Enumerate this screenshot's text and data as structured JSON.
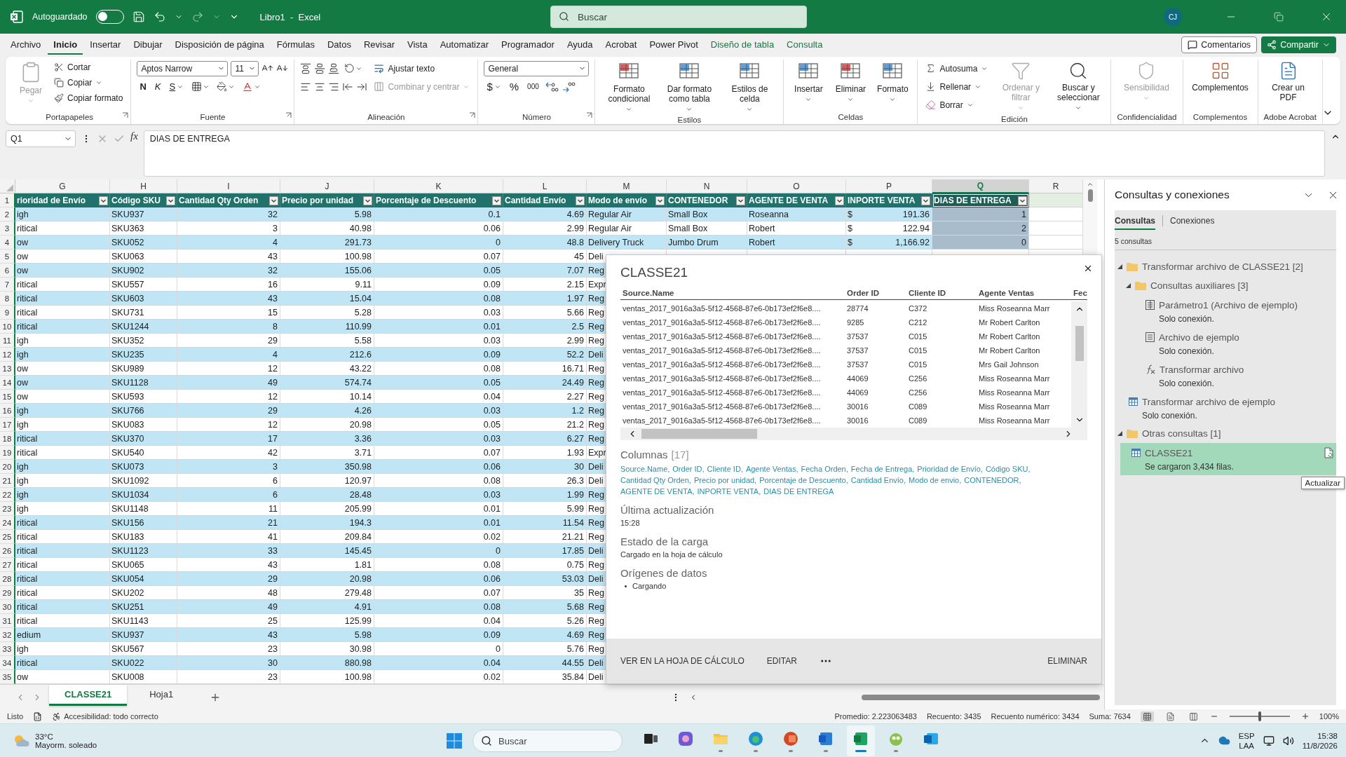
{
  "title_bar": {
    "autosave_label": "Autoguardado",
    "autosave_on": false,
    "title": "Libro1  -  Excel",
    "search_placeholder": "Buscar",
    "avatar": "CJ"
  },
  "menu_tabs": [
    {
      "label": "Archivo",
      "selected": false,
      "contextual": false
    },
    {
      "label": "Inicio",
      "selected": true,
      "contextual": false
    },
    {
      "label": "Insertar",
      "selected": false,
      "contextual": false
    },
    {
      "label": "Dibujar",
      "selected": false,
      "contextual": false
    },
    {
      "label": "Disposición de página",
      "selected": false,
      "contextual": false
    },
    {
      "label": "Fórmulas",
      "selected": false,
      "contextual": false
    },
    {
      "label": "Datos",
      "selected": false,
      "contextual": false
    },
    {
      "label": "Revisar",
      "selected": false,
      "contextual": false
    },
    {
      "label": "Vista",
      "selected": false,
      "contextual": false
    },
    {
      "label": "Automatizar",
      "selected": false,
      "contextual": false
    },
    {
      "label": "Programador",
      "selected": false,
      "contextual": false
    },
    {
      "label": "Ayuda",
      "selected": false,
      "contextual": false
    },
    {
      "label": "Acrobat",
      "selected": false,
      "contextual": false
    },
    {
      "label": "Power Pivot",
      "selected": false,
      "contextual": false
    },
    {
      "label": "Diseño de tabla",
      "selected": false,
      "contextual": true
    },
    {
      "label": "Consulta",
      "selected": false,
      "contextual": true
    }
  ],
  "header_buttons": {
    "comments": "Comentarios",
    "share": "Compartir"
  },
  "ribbon": [
    {
      "kind": "clipboard",
      "label": "Portapapeles",
      "paste": {
        "label": "Pegar",
        "disabled": true
      },
      "actions": [
        {
          "label": "Cortar"
        },
        {
          "label": "Copiar"
        },
        {
          "label": "Copiar formato"
        }
      ]
    },
    {
      "kind": "font",
      "label": "Fuente",
      "font_name": "Aptos Narrow",
      "font_size": "11",
      "styles": [
        "N",
        "K",
        "S"
      ]
    },
    {
      "kind": "alignment",
      "label": "Alineación",
      "wrap": {
        "label": "Ajustar texto",
        "disabled": false
      },
      "merge": {
        "label": "Combinar y centrar",
        "disabled": true
      }
    },
    {
      "kind": "number",
      "label": "Número",
      "format": "General",
      "symbols": [
        "$",
        "%",
        "000"
      ]
    },
    {
      "kind": "styles",
      "label": "Estilos",
      "buttons": [
        {
          "label": "Formato condicional"
        },
        {
          "label": "Dar formato como tabla"
        },
        {
          "label": "Estilos de celda"
        }
      ]
    },
    {
      "kind": "cells",
      "label": "Celdas",
      "buttons": [
        {
          "label": "Insertar"
        },
        {
          "label": "Eliminar"
        },
        {
          "label": "Formato"
        }
      ]
    },
    {
      "kind": "editing",
      "label": "Edición",
      "actions": [
        {
          "label": "Autosuma"
        },
        {
          "label": "Rellenar"
        },
        {
          "label": "Borrar"
        }
      ],
      "buttons": [
        {
          "label": "Ordenar y filtrar",
          "disabled": true
        },
        {
          "label": "Buscar y seleccionar",
          "disabled": false
        }
      ]
    },
    {
      "kind": "sensitivity",
      "label": "Confidencialidad",
      "buttons": [
        {
          "label": "Sensibilidad",
          "disabled": true
        }
      ]
    },
    {
      "kind": "addins",
      "label": "Complementos",
      "buttons": [
        {
          "label": "Complementos"
        }
      ]
    },
    {
      "kind": "acrobat",
      "label": "Adobe Acrobat",
      "buttons": [
        {
          "label": "Crear un PDF"
        }
      ]
    }
  ],
  "formula_bar": {
    "name_box": "Q1",
    "fx": "fx",
    "formula": "DIAS DE ENTREGA"
  },
  "sheet": {
    "column_letters": [
      {
        "letter": "G",
        "selected": false
      },
      {
        "letter": "H",
        "selected": false
      },
      {
        "letter": "I",
        "selected": false
      },
      {
        "letter": "J",
        "selected": false
      },
      {
        "letter": "K",
        "selected": false
      },
      {
        "letter": "L",
        "selected": false
      },
      {
        "letter": "M",
        "selected": false
      },
      {
        "letter": "N",
        "selected": false
      },
      {
        "letter": "O",
        "selected": false
      },
      {
        "letter": "P",
        "selected": false
      },
      {
        "letter": "Q",
        "selected": true
      },
      {
        "letter": "R",
        "selected": false
      }
    ],
    "header_row": {
      "number": "1",
      "labels": [
        "rioridad de Envío",
        "Código SKU",
        "Cantidad Qty Orden",
        "Precio por unidad",
        "Porcentaje de Descuento",
        "Cantidad Envío",
        "Modo de envío",
        "CONTENEDOR",
        "AGENTE DE VENTA",
        "INPORTE VENTA",
        "DIAS DE ENTREGA"
      ]
    },
    "rows": [
      {
        "number": "2",
        "currency": "$",
        "cells": [
          "igh",
          "SKU937",
          "32",
          "5.98",
          "0.1",
          "4.69",
          "Regular Air",
          "Small Box",
          "Roseanna",
          "191.36",
          "1"
        ]
      },
      {
        "number": "3",
        "currency": "$",
        "cells": [
          "ritical",
          "SKU363",
          "3",
          "40.98",
          "0.06",
          "2.99",
          "Regular Air",
          "Small Box",
          "Robert",
          "122.94",
          "2"
        ]
      },
      {
        "number": "4",
        "currency": "$",
        "cells": [
          "ow",
          "SKU052",
          "4",
          "291.73",
          "0",
          "48.8",
          "Delivery Truck",
          "Jumbo Drum",
          "Robert",
          "1,166.92",
          "0"
        ]
      },
      {
        "number": "5",
        "cells": [
          "ow",
          "SKU063",
          "43",
          "100.98",
          "0.07",
          "45",
          "Deli"
        ]
      },
      {
        "number": "6",
        "cells": [
          "ow",
          "SKU902",
          "32",
          "155.06",
          "0.05",
          "7.07",
          "Reg"
        ]
      },
      {
        "number": "7",
        "cells": [
          "ritical",
          "SKU557",
          "16",
          "9.11",
          "0.09",
          "2.15",
          "Expr"
        ]
      },
      {
        "number": "8",
        "cells": [
          "ritical",
          "SKU603",
          "43",
          "15.04",
          "0.08",
          "1.97",
          "Reg"
        ]
      },
      {
        "number": "9",
        "cells": [
          "ritical",
          "SKU731",
          "15",
          "5.28",
          "0.03",
          "5.66",
          "Reg"
        ]
      },
      {
        "number": "10",
        "cells": [
          "ritical",
          "SKU1244",
          "8",
          "110.99",
          "0.01",
          "2.5",
          "Reg"
        ]
      },
      {
        "number": "11",
        "cells": [
          "igh",
          "SKU352",
          "29",
          "5.58",
          "0.03",
          "2.99",
          "Reg"
        ]
      },
      {
        "number": "12",
        "cells": [
          "igh",
          "SKU235",
          "4",
          "212.6",
          "0.09",
          "52.2",
          "Deli"
        ]
      },
      {
        "number": "13",
        "cells": [
          "ow",
          "SKU989",
          "12",
          "43.22",
          "0.08",
          "16.71",
          "Reg"
        ]
      },
      {
        "number": "14",
        "cells": [
          "ow",
          "SKU1128",
          "49",
          "574.74",
          "0.05",
          "24.49",
          "Reg"
        ]
      },
      {
        "number": "15",
        "cells": [
          "ow",
          "SKU593",
          "12",
          "10.14",
          "0.04",
          "2.27",
          "Reg"
        ]
      },
      {
        "number": "16",
        "cells": [
          "igh",
          "SKU766",
          "29",
          "4.26",
          "0.03",
          "1.2",
          "Reg"
        ]
      },
      {
        "number": "17",
        "cells": [
          "igh",
          "SKU083",
          "12",
          "20.98",
          "0.05",
          "21.2",
          "Reg"
        ]
      },
      {
        "number": "18",
        "cells": [
          "ritical",
          "SKU370",
          "17",
          "3.36",
          "0.03",
          "6.27",
          "Reg"
        ]
      },
      {
        "number": "19",
        "cells": [
          "ritical",
          "SKU540",
          "42",
          "3.71",
          "0.07",
          "1.93",
          "Expr"
        ]
      },
      {
        "number": "20",
        "cells": [
          "igh",
          "SKU073",
          "3",
          "350.98",
          "0.06",
          "30",
          "Deli"
        ]
      },
      {
        "number": "21",
        "cells": [
          "igh",
          "SKU1092",
          "6",
          "120.97",
          "0.08",
          "26.3",
          "Deli"
        ]
      },
      {
        "number": "22",
        "cells": [
          "igh",
          "SKU1034",
          "6",
          "28.48",
          "0.03",
          "1.99",
          "Reg"
        ]
      },
      {
        "number": "23",
        "cells": [
          "igh",
          "SKU1148",
          "11",
          "205.99",
          "0.01",
          "5.99",
          "Reg"
        ]
      },
      {
        "number": "24",
        "cells": [
          "ritical",
          "SKU156",
          "21",
          "194.3",
          "0.01",
          "11.54",
          "Reg"
        ]
      },
      {
        "number": "25",
        "cells": [
          "ritical",
          "SKU183",
          "41",
          "209.84",
          "0.02",
          "21.21",
          "Reg"
        ]
      },
      {
        "number": "26",
        "cells": [
          "ritical",
          "SKU1123",
          "33",
          "145.45",
          "0",
          "17.85",
          "Deli"
        ]
      },
      {
        "number": "27",
        "cells": [
          "ritical",
          "SKU065",
          "43",
          "1.81",
          "0.08",
          "0.75",
          "Reg"
        ]
      },
      {
        "number": "28",
        "cells": [
          "ritical",
          "SKU054",
          "29",
          "20.98",
          "0.06",
          "53.03",
          "Deli"
        ]
      },
      {
        "number": "29",
        "cells": [
          "ritical",
          "SKU202",
          "48",
          "279.48",
          "0.07",
          "35",
          "Reg"
        ]
      },
      {
        "number": "30",
        "cells": [
          "ritical",
          "SKU251",
          "49",
          "4.91",
          "0.08",
          "5.68",
          "Reg"
        ]
      },
      {
        "number": "31",
        "cells": [
          "ritical",
          "SKU1143",
          "25",
          "125.99",
          "0.04",
          "5.26",
          "Reg"
        ]
      },
      {
        "number": "32",
        "cells": [
          "edium",
          "SKU937",
          "43",
          "5.98",
          "0.09",
          "4.69",
          "Reg"
        ]
      },
      {
        "number": "33",
        "cells": [
          "igh",
          "SKU567",
          "23",
          "30.98",
          "0",
          "5.76",
          "Reg"
        ]
      },
      {
        "number": "34",
        "cells": [
          "ritical",
          "SKU022",
          "30",
          "880.98",
          "0.04",
          "44.55",
          "Deli"
        ]
      },
      {
        "number": "35",
        "cells": [
          "ow",
          "SKU008",
          "23",
          "100.98",
          "0.02",
          "35.84",
          "Deli"
        ]
      }
    ],
    "sheet_tabs": [
      {
        "label": "CLASSE21",
        "selected": true
      },
      {
        "label": "Hoja1",
        "selected": false
      }
    ]
  },
  "query_flyout": {
    "title": "CLASSE21",
    "preview": {
      "columns": [
        "Source.Name",
        "Order ID",
        "Cliente ID",
        "Agente Ventas",
        "Fec"
      ],
      "rows": [
        [
          "ventas_2017_9016a3a5-5f12-4568-87e6-0b173ef2f6e8....",
          "28774",
          "C372",
          "Miss Roseanna Marr"
        ],
        [
          "ventas_2017_9016a3a5-5f12-4568-87e6-0b173ef2f6e8....",
          "9285",
          "C212",
          "Mr Robert Carlton"
        ],
        [
          "ventas_2017_9016a3a5-5f12-4568-87e6-0b173ef2f6e8....",
          "37537",
          "C015",
          "Mr Robert Carlton"
        ],
        [
          "ventas_2017_9016a3a5-5f12-4568-87e6-0b173ef2f6e8....",
          "37537",
          "C015",
          "Mr Robert Carlton"
        ],
        [
          "ventas_2017_9016a3a5-5f12-4568-87e6-0b173ef2f6e8....",
          "37537",
          "C015",
          "Mrs Gail Johnson"
        ],
        [
          "ventas_2017_9016a3a5-5f12-4568-87e6-0b173ef2f6e8....",
          "44069",
          "C256",
          "Miss Roseanna Marr"
        ],
        [
          "ventas_2017_9016a3a5-5f12-4568-87e6-0b173ef2f6e8....",
          "44069",
          "C256",
          "Miss Roseanna Marr"
        ],
        [
          "ventas_2017_9016a3a5-5f12-4568-87e6-0b173ef2f6e8....",
          "30016",
          "C089",
          "Miss Roseanna Marr"
        ],
        [
          "ventas_2017_9016a3a5-5f12-4568-87e6-0b173ef2f6e8....",
          "30016",
          "C089",
          "Miss Roseanna Marr"
        ]
      ]
    },
    "columns_heading": "Columnas",
    "columns_count": "[17]",
    "column_names": [
      "Source.Name,",
      "Order ID,",
      "Cliente ID,",
      "Agente Ventas,",
      "Fecha Orden,",
      "Fecha de Entrega,",
      "Prioridad de Envío,",
      "Código SKU,",
      "Cantidad Qty Orden,",
      "Precio por unidad,",
      "Porcentaje de Descuento,",
      "Cantidad Envío,",
      "Modo de envio,",
      "CONTENEDOR,",
      "AGENTE DE VENTA,",
      "INPORTE VENTA,",
      "DIAS DE ENTREGA"
    ],
    "sections": [
      {
        "heading": "Última actualización",
        "value": "15:28"
      },
      {
        "heading": "Estado de la carga",
        "value": "Cargado en la hoja de cálculo"
      }
    ],
    "sources_heading": "Orígenes de datos",
    "sources": [
      "Cargando"
    ],
    "actions": [
      "VER EN LA HOJA DE CÁLCULO",
      "EDITAR"
    ],
    "delete": "ELIMINAR"
  },
  "queries_panel": {
    "title": "Consultas y conexiones",
    "tabs": [
      {
        "label": "Consultas",
        "selected": true
      },
      {
        "label": "Conexiones",
        "selected": false
      }
    ],
    "count": "5 consultas",
    "tree": [
      {
        "kind": "folder",
        "label": "Transformar archivo de CLASSE21 [2]",
        "expanded": true,
        "selected": false,
        "children": [
          {
            "kind": "folder",
            "label": "Consultas auxiliares [3]",
            "expanded": true,
            "selected": false,
            "children": [
              {
                "kind": "parameter",
                "label": "Parámetro1 (Archivo de ejemplo)",
                "status": "Solo conexión.",
                "selected": false
              },
              {
                "kind": "file",
                "label": "Archivo de ejemplo",
                "status": "Solo conexión.",
                "selected": false
              },
              {
                "kind": "function",
                "label": "Transformar archivo",
                "status": "Solo conexión.",
                "selected": false
              }
            ]
          },
          {
            "kind": "table",
            "label": "Transformar archivo de ejemplo",
            "status": "Solo conexión.",
            "selected": false
          }
        ]
      },
      {
        "kind": "folder",
        "label": "Otras consultas [1]",
        "expanded": true,
        "selected": false,
        "children": [
          {
            "kind": "table",
            "label": "CLASSE21",
            "status": "Se cargaron 3,434 filas.",
            "selected": true
          }
        ]
      }
    ],
    "tooltip": "Actualizar"
  },
  "status_bar": {
    "ready": "Listo",
    "accessibility": "Accesibilidad: todo correcto",
    "stats": [
      "Promedio: 2.223063483",
      "Recuento: 3435",
      "Recuento numérico: 3434",
      "Suma: 7634"
    ],
    "views": [
      {
        "selected": true
      },
      {
        "selected": false
      },
      {
        "selected": false
      }
    ],
    "zoom": {
      "level": 0.5,
      "label": "100%"
    }
  },
  "taskbar": {
    "weather": {
      "temp": "33°C",
      "desc": "Mayorm. soleado"
    },
    "search_placeholder": "Buscar",
    "apps": [
      {
        "running": false,
        "active": false
      },
      {
        "running": false,
        "active": false
      },
      {
        "running": true,
        "active": false
      },
      {
        "running": true,
        "active": false
      },
      {
        "running": true,
        "active": false
      },
      {
        "running": true,
        "active": false
      },
      {
        "running": true,
        "active": true
      },
      {
        "running": true,
        "active": false
      },
      {
        "running": false,
        "active": false
      }
    ],
    "language": "ESP",
    "layout": "LAA",
    "time": "15:38",
    "date": "11/8/2026"
  }
}
